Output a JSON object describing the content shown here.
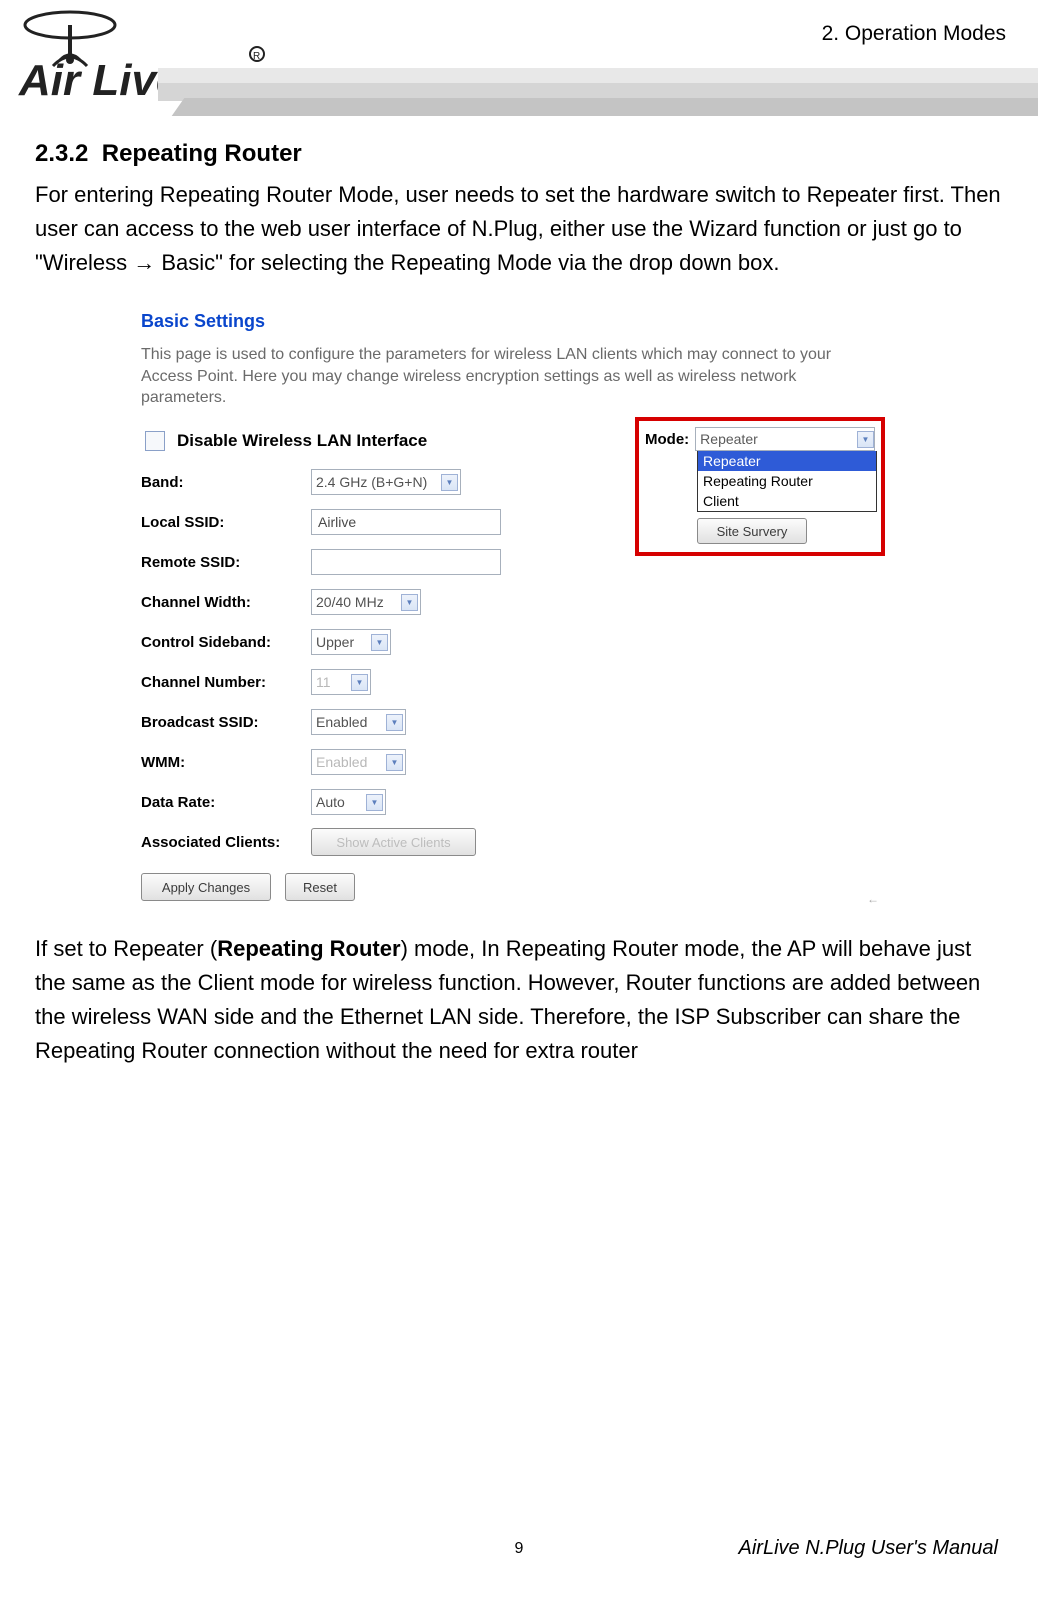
{
  "header": {
    "chapter_label": "2. Operation Modes",
    "logo_text": "Air Live"
  },
  "section": {
    "number": "2.3.2",
    "title": "Repeating Router",
    "intro": "For entering Repeating Router Mode, user needs to set the hardware switch to Repeater first. Then user can access to the web user interface of N.Plug, either use the Wizard function or just go to \"Wireless → Basic\" for selecting the Repeating Mode via the drop down box."
  },
  "screenshot": {
    "title": "Basic Settings",
    "description": "This page is used to configure the parameters for wireless LAN clients which may connect to your Access Point. Here you may change wireless encryption settings as well as wireless network parameters.",
    "disable_checkbox_label": "Disable Wireless LAN Interface",
    "rows": {
      "band": {
        "label": "Band:",
        "value": "2.4 GHz (B+G+N)"
      },
      "local_ssid": {
        "label": "Local SSID:",
        "value": "Airlive"
      },
      "remote_ssid": {
        "label": "Remote SSID:",
        "value": ""
      },
      "channel_width": {
        "label": "Channel Width:",
        "value": "20/40 MHz"
      },
      "control_sideband": {
        "label": "Control Sideband:",
        "value": "Upper"
      },
      "channel_number": {
        "label": "Channel Number:",
        "value": "11"
      },
      "broadcast_ssid": {
        "label": "Broadcast SSID:",
        "value": "Enabled"
      },
      "wmm": {
        "label": "WMM:",
        "value": "Enabled"
      },
      "data_rate": {
        "label": "Data Rate:",
        "value": "Auto"
      },
      "assoc_clients": {
        "label": "Associated Clients:",
        "button": "Show Active Clients"
      }
    },
    "mode": {
      "label": "Mode:",
      "selected": "Repeater",
      "options": [
        "Repeater",
        "Repeating Router",
        "Client"
      ],
      "site_survey_button": "Site Survery"
    },
    "buttons": {
      "apply": "Apply Changes",
      "reset": "Reset"
    }
  },
  "after_text": {
    "pre": "If set to Repeater (",
    "bold": "Repeating Router",
    "post": ") mode, In Repeating Router mode, the AP will behave just the same as the Client mode for wireless function. However, Router functions are added between the wireless WAN side and the Ethernet LAN side. Therefore, the ISP Subscriber can share the Repeating Router connection without the need for extra router"
  },
  "footer": {
    "page_number": "9",
    "manual_name": "AirLive N.Plug User's Manual"
  }
}
